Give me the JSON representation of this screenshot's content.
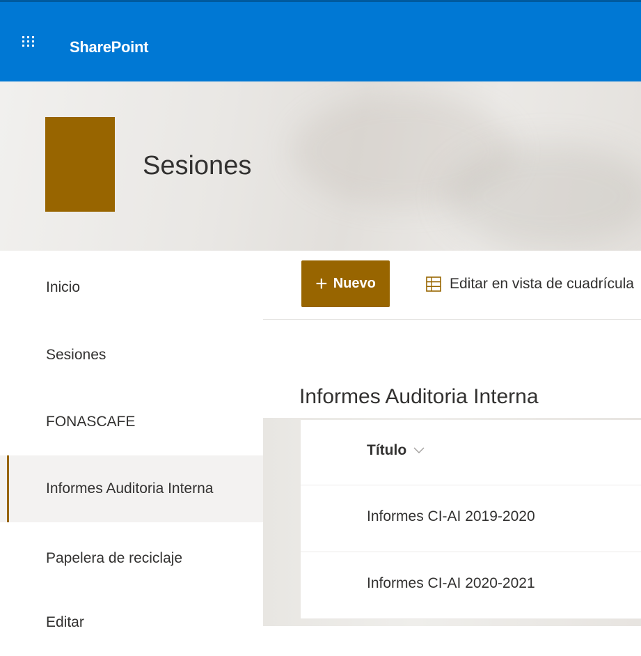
{
  "suite_bar": {
    "app_name": "SharePoint",
    "color": "#0078d4"
  },
  "site": {
    "title": "Sesiones",
    "logo_color": "#986500"
  },
  "left_nav": {
    "items": [
      {
        "label": "Inicio",
        "selected": false
      },
      {
        "label": "Sesiones",
        "selected": false
      },
      {
        "label": "FONASCAFE",
        "selected": false
      },
      {
        "label": "Informes Auditoria Interna",
        "selected": true
      },
      {
        "label": "Papelera de reciclaje",
        "selected": false
      },
      {
        "label": "Editar",
        "selected": false
      }
    ],
    "accent_color": "#986500"
  },
  "command_bar": {
    "new_label": "Nuevo",
    "grid_edit_label": "Editar en vista de cuadrícula"
  },
  "list": {
    "title": "Informes Auditoria Interna",
    "columns": [
      {
        "label": "Título"
      }
    ],
    "rows": [
      {
        "title": "Informes CI-AI 2019-2020"
      },
      {
        "title": "Informes CI-AI 2020-2021"
      }
    ]
  },
  "icons": {
    "waffle": "app-launcher-icon",
    "plus": "plus-icon",
    "grid": "grid-edit-icon",
    "chevron": "chevron-down-icon"
  }
}
